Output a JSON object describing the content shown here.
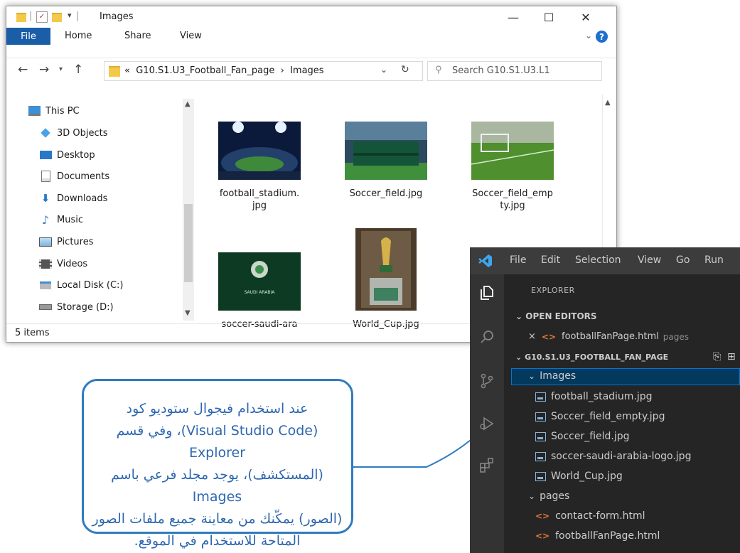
{
  "explorer": {
    "title": "Images",
    "ribbon_tabs": [
      "File",
      "Home",
      "Share",
      "View"
    ],
    "window_buttons": {
      "minimize": "—",
      "maximize": "☐",
      "close": "✕"
    },
    "help": "?",
    "address": {
      "prefix": "«",
      "path_parent": "G10.S1.U3_Football_Fan_page",
      "separator": "›",
      "path_current": "Images"
    },
    "search_placeholder": "Search G10.S1.U3.L1",
    "nav_items": [
      {
        "label": "This PC",
        "icon": "computer-icon"
      },
      {
        "label": "3D Objects",
        "icon": "cube-icon"
      },
      {
        "label": "Desktop",
        "icon": "desktop-icon"
      },
      {
        "label": "Documents",
        "icon": "document-icon"
      },
      {
        "label": "Downloads",
        "icon": "download-arrow-icon"
      },
      {
        "label": "Music",
        "icon": "music-note-icon"
      },
      {
        "label": "Pictures",
        "icon": "pictures-icon"
      },
      {
        "label": "Videos",
        "icon": "film-icon"
      },
      {
        "label": "Local Disk (C:)",
        "icon": "disk-icon"
      },
      {
        "label": "Storage (D:)",
        "icon": "drive-icon"
      }
    ],
    "files": [
      {
        "name_line1": "football_stadium.",
        "name_line2": "jpg"
      },
      {
        "name_line1": "Soccer_field.jpg",
        "name_line2": ""
      },
      {
        "name_line1": "Soccer_field_emp",
        "name_line2": "ty.jpg"
      },
      {
        "name_line1": "soccer-saudi-ara",
        "name_line2": ""
      },
      {
        "name_line1": "World_Cup.jpg",
        "name_line2": ""
      }
    ],
    "thumb_caption": "SAUDI ARABIA",
    "status": "5 items"
  },
  "vscode": {
    "menu": [
      "File",
      "Edit",
      "Selection",
      "View",
      "Go",
      "Run"
    ],
    "explorer_title": "EXPLORER",
    "open_editors_label": "OPEN EDITORS",
    "open_editor": {
      "close": "×",
      "icon": "<>",
      "file": "footballFanPage.html",
      "folder": "pages"
    },
    "project_label": "G10.S1.U3_FOOTBALL_FAN_PAGE",
    "images_folder": "Images",
    "image_files": [
      "football_stadium.jpg",
      "Soccer_field_empty.jpg",
      "Soccer_field.jpg",
      "soccer-saudi-arabia-logo.jpg",
      "World_Cup.jpg"
    ],
    "pages_folder": "pages",
    "page_files": [
      "contact-form.html",
      "footballFanPage.html"
    ],
    "chevron_down": "⌄",
    "html_icon": "<>"
  },
  "callout": {
    "lines": [
      "عند استخدام فيجوال ستوديو كود",
      "(Visual Studio Code)، وفي قسم Explorer",
      "(المستكشف)، يوجد مجلد فرعي باسم Images",
      "(الصور) يمكّنك من معاينة جميع ملفات الصور",
      "المتاحة للاستخدام في الموقع."
    ]
  },
  "colors": {
    "accent": "#1a5ea8",
    "vscode_bg": "#252526",
    "callout_border": "#2f7bbf",
    "callout_text": "#2d67b0"
  }
}
